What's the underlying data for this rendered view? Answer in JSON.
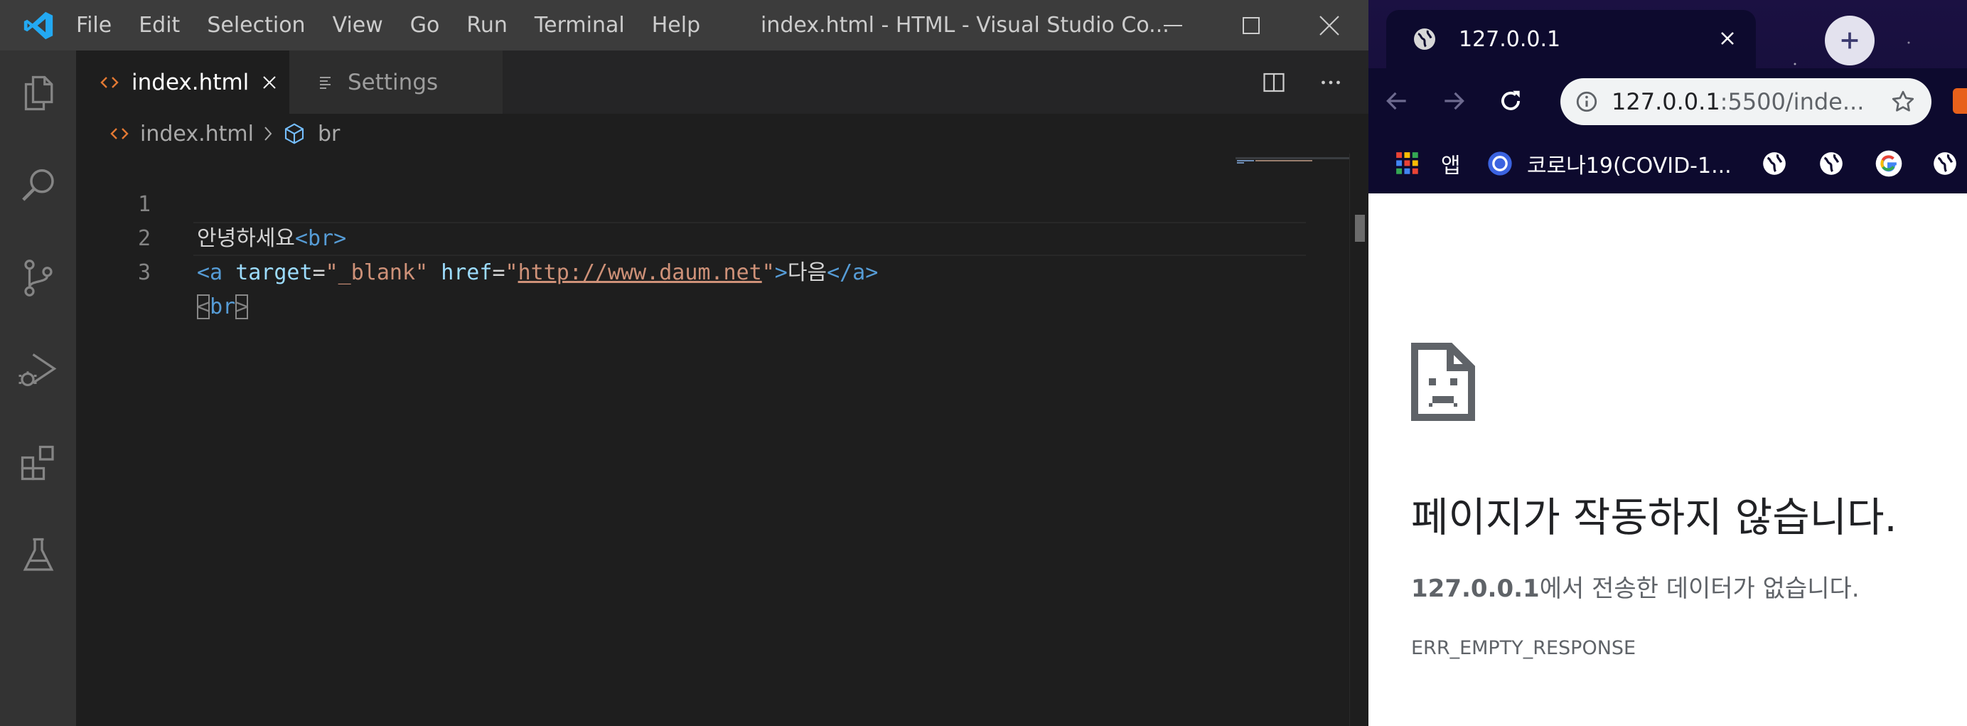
{
  "vscode": {
    "menu": [
      "File",
      "Edit",
      "Selection",
      "View",
      "Go",
      "Run",
      "Terminal",
      "Help"
    ],
    "window_title": "index.html - HTML - Visual Studio Co...",
    "tabs": [
      {
        "label": "index.html",
        "active": true
      },
      {
        "label": "Settings",
        "active": false
      }
    ],
    "breadcrumb": {
      "file": "index.html",
      "symbol": "br"
    },
    "code": {
      "line_numbers": [
        "1",
        "2",
        "3"
      ],
      "line1": {
        "text": "안녕하세요",
        "tag": "<br>"
      },
      "line2": {
        "open": "<a",
        "attr1": "target",
        "eq1": "=",
        "val1": "\"_blank\"",
        "attr2": "href",
        "eq2": "=",
        "q_open": "\"",
        "url": "http://www.daum.net",
        "q_close": "\"",
        "gt": ">",
        "text": "다음",
        "close": "</a>"
      },
      "line3": {
        "lt": "<",
        "name": "br",
        "gt": ">"
      }
    },
    "colors": {
      "editor_bg": "#1e1e1e",
      "titlebar_bg": "#3c3c3c",
      "activitybar_bg": "#333333",
      "logo_blue": "#23a9f2"
    }
  },
  "chrome": {
    "tab_title": "127.0.0.1",
    "address": {
      "host": "127.0.0.1",
      "rest": ":5500/inde..."
    },
    "bookmarks": {
      "apps_label": "앱",
      "corona_label": "코로나19(COVID-1..."
    },
    "error": {
      "title": "페이지가 작동하지 않습니다.",
      "desc_host": "127.0.0.1",
      "desc_rest": "에서 전송한 데이터가 없습니다.",
      "code": "ERR_EMPTY_RESPONSE"
    }
  }
}
